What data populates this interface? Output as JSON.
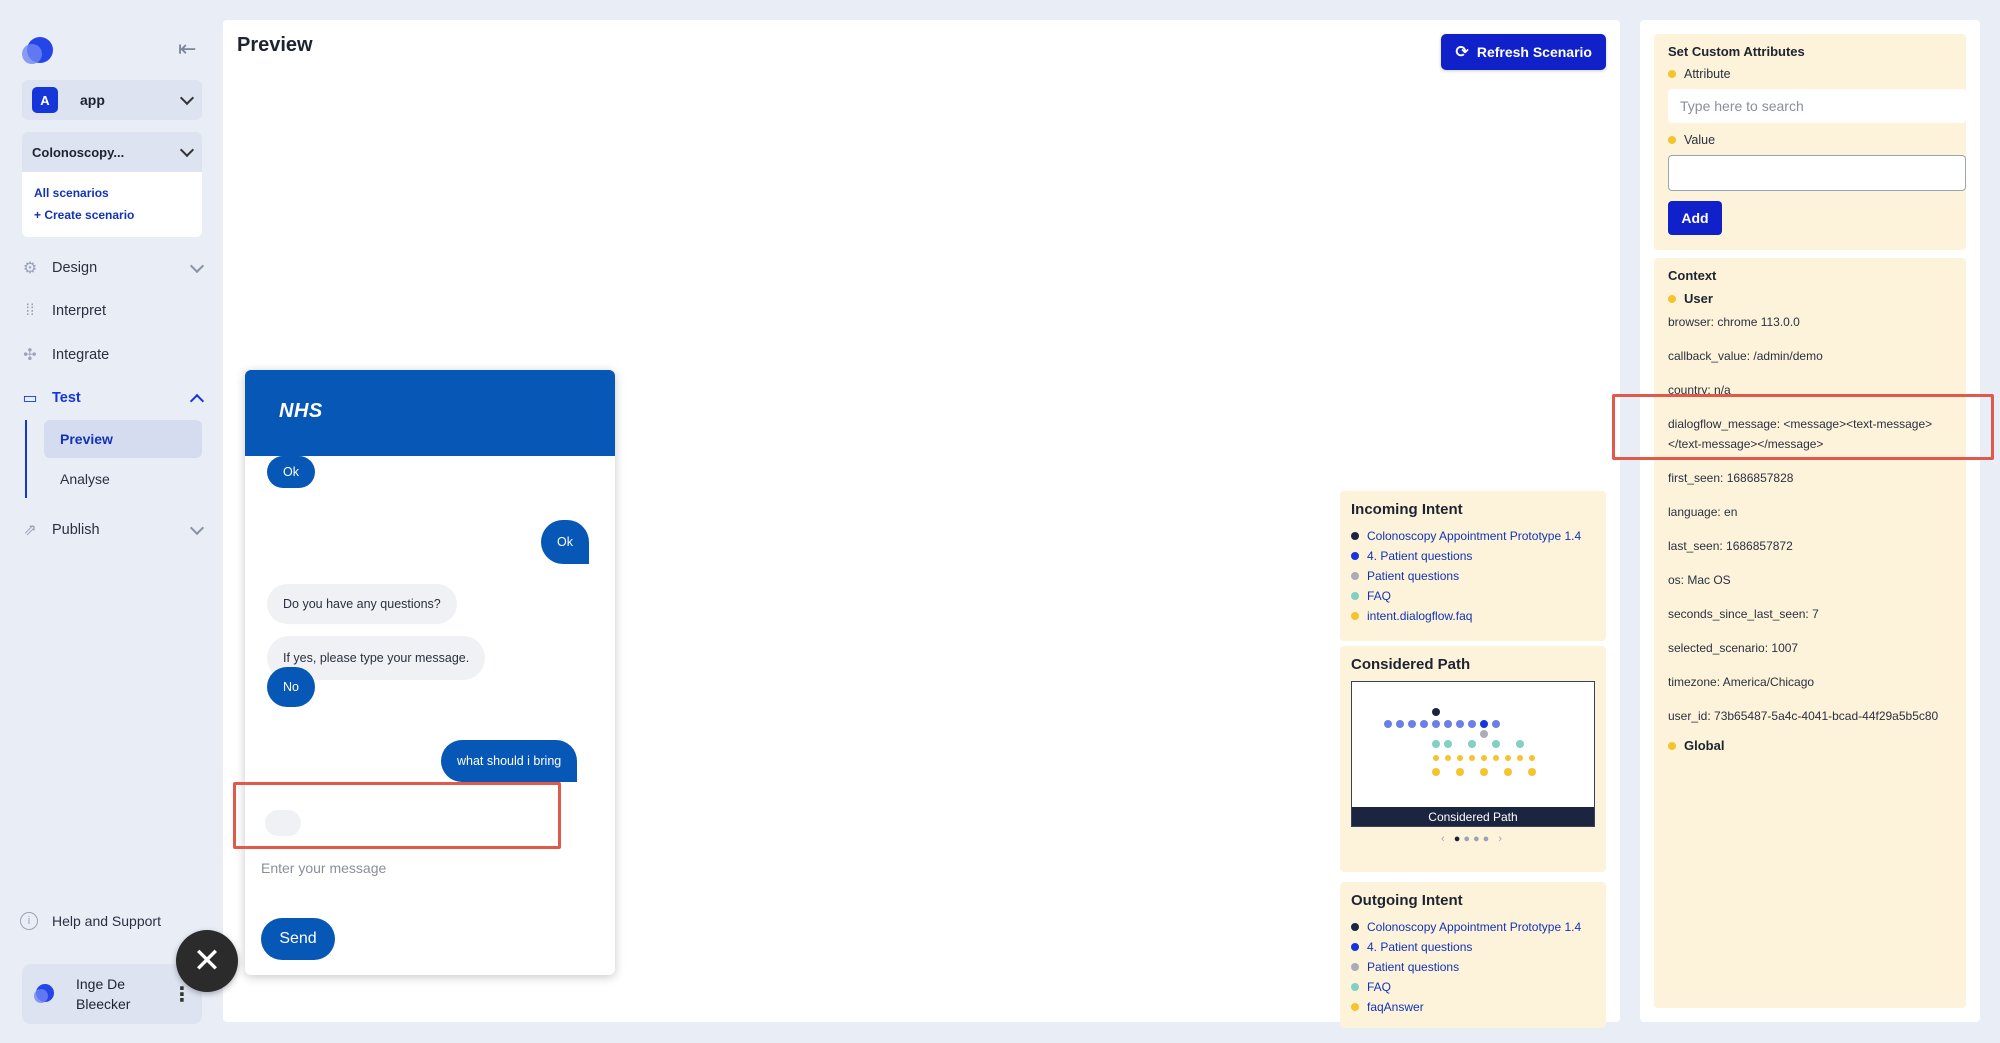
{
  "sidebar": {
    "app_avatar": "A",
    "app_name": "app",
    "scenario_name": "Colonoscopy...",
    "all_scenarios": "All scenarios",
    "create_scenario": "+ Create scenario",
    "nav": {
      "design": "Design",
      "interpret": "Interpret",
      "integrate": "Integrate",
      "test": "Test",
      "publish": "Publish"
    },
    "sub": {
      "preview": "Preview",
      "analyse": "Analyse"
    },
    "help": "Help and Support",
    "user_name": "Inge De Bleecker"
  },
  "main": {
    "title": "Preview",
    "refresh": "Refresh Scenario"
  },
  "chat": {
    "brand": "NHS",
    "messages": [
      "Ok",
      "Ok",
      "Do you have any questions?",
      "If yes, please type your message.",
      "No",
      "what should i bring"
    ],
    "placeholder": "Enter your message",
    "send": "Send"
  },
  "incoming": {
    "title": "Incoming Intent",
    "items": [
      "Colonoscopy Appointment Prototype 1.4",
      "4. Patient questions",
      "Patient questions",
      "FAQ",
      "intent.dialogflow.faq"
    ]
  },
  "considered": {
    "title": "Considered Path",
    "caption": "Considered Path"
  },
  "outgoing": {
    "title": "Outgoing Intent",
    "items": [
      "Colonoscopy Appointment Prototype 1.4",
      "4. Patient questions",
      "Patient questions",
      "FAQ",
      "faqAnswer"
    ]
  },
  "attributes": {
    "title": "Set Custom Attributes",
    "attr_label": "Attribute",
    "attr_placeholder": "Type here to search",
    "value_label": "Value",
    "add": "Add"
  },
  "context": {
    "title": "Context",
    "user": "User",
    "lines": [
      "browser: chrome 113.0.0",
      "callback_value: /admin/demo",
      "country: n/a",
      "dialogflow_message: <message><text-message></text-message></message>",
      "first_seen: 1686857828",
      "language: en",
      "last_seen: 1686857872",
      "os: Mac OS",
      "seconds_since_last_seen: 7",
      "selected_scenario: 1007",
      "timezone: America/Chicago",
      "user_id: 73b65487-5a4c-4041-bcad-44f29a5b5c80"
    ],
    "global": "Global"
  },
  "colors": {
    "accent": "#1021c9",
    "nhs_blue": "#0758b6",
    "card_bg": "#fdf3da",
    "highlight": "#e0594a",
    "dot_colors": [
      "#1b2540",
      "#1736d9",
      "#a9adb8",
      "#7fd1c0",
      "#f5c32c"
    ]
  }
}
